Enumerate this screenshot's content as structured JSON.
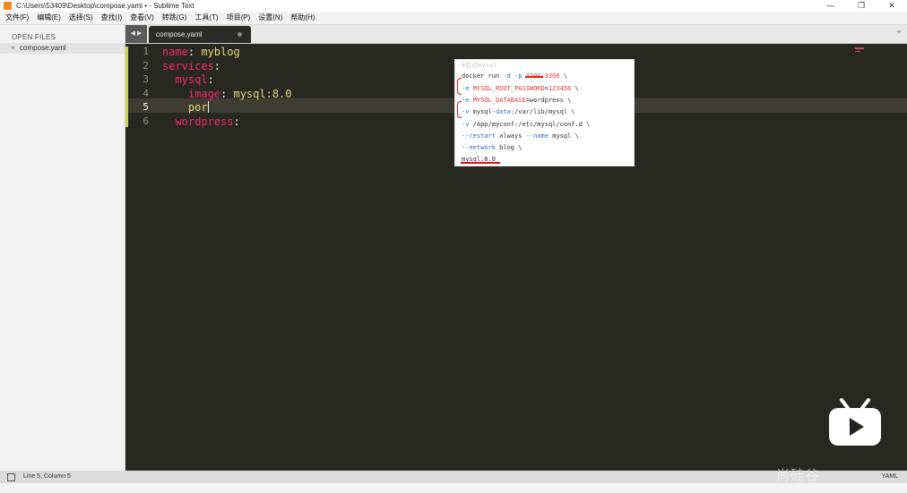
{
  "window": {
    "title": "C:\\Users\\53409\\Desktop\\compose.yaml • - Sublime Text",
    "controls": [
      "—",
      "❐",
      "✕"
    ]
  },
  "menu": [
    "文件(F)",
    "编辑(E)",
    "选择(S)",
    "查找(I)",
    "查看(V)",
    "转跳(G)",
    "工具(T)",
    "项目(P)",
    "设置(N)",
    "帮助(H)"
  ],
  "sidebar": {
    "header": "OPEN FILES",
    "files": [
      {
        "close": "×",
        "name": "compose.yaml"
      }
    ]
  },
  "tabs": {
    "nav": "◀ ▶",
    "active": "compose.yaml",
    "new_tab": "+"
  },
  "editor": {
    "lines": [
      {
        "num": "1",
        "key": "name",
        "sep": ": ",
        "value": "myblog",
        "indent": ""
      },
      {
        "num": "2",
        "key": "services",
        "sep": ":",
        "value": "",
        "indent": ""
      },
      {
        "num": "3",
        "key": "mysql",
        "sep": ":",
        "value": "",
        "indent": "  "
      },
      {
        "num": "4",
        "key": "image",
        "sep": ": ",
        "value": "mysql:8.0",
        "indent": "    "
      },
      {
        "num": "5",
        "key": "",
        "sep": "",
        "value": "",
        "text": "por",
        "indent": "    "
      },
      {
        "num": "6",
        "key": "wordpress",
        "sep": ":",
        "value": "",
        "indent": "  "
      }
    ],
    "current_line": 5
  },
  "snippet": {
    "lines": [
      "#启动mysql",
      "docker run -d -p 3306:3306 \\",
      "-e MYSQL_ROOT_PASSWORD=123456 \\",
      "-e MYSQL_DATABASE=wordpress \\",
      "-v mysql-data:/var/lib/mysql \\",
      "-v /app/myconf:/etc/mysql/conf.d \\",
      "--restart always --name mysql \\",
      "--network blog \\",
      "mysql:8.0"
    ]
  },
  "status": {
    "position": "Line 5, Column 5",
    "syntax": "YAML"
  },
  "watermark": "尚硅谷",
  "colors": {
    "editor_bg": "#272822",
    "keyword": "#f92672",
    "value": "#e6db74",
    "annotation": "#d11111",
    "bilibili_logo": "#ffffff"
  }
}
